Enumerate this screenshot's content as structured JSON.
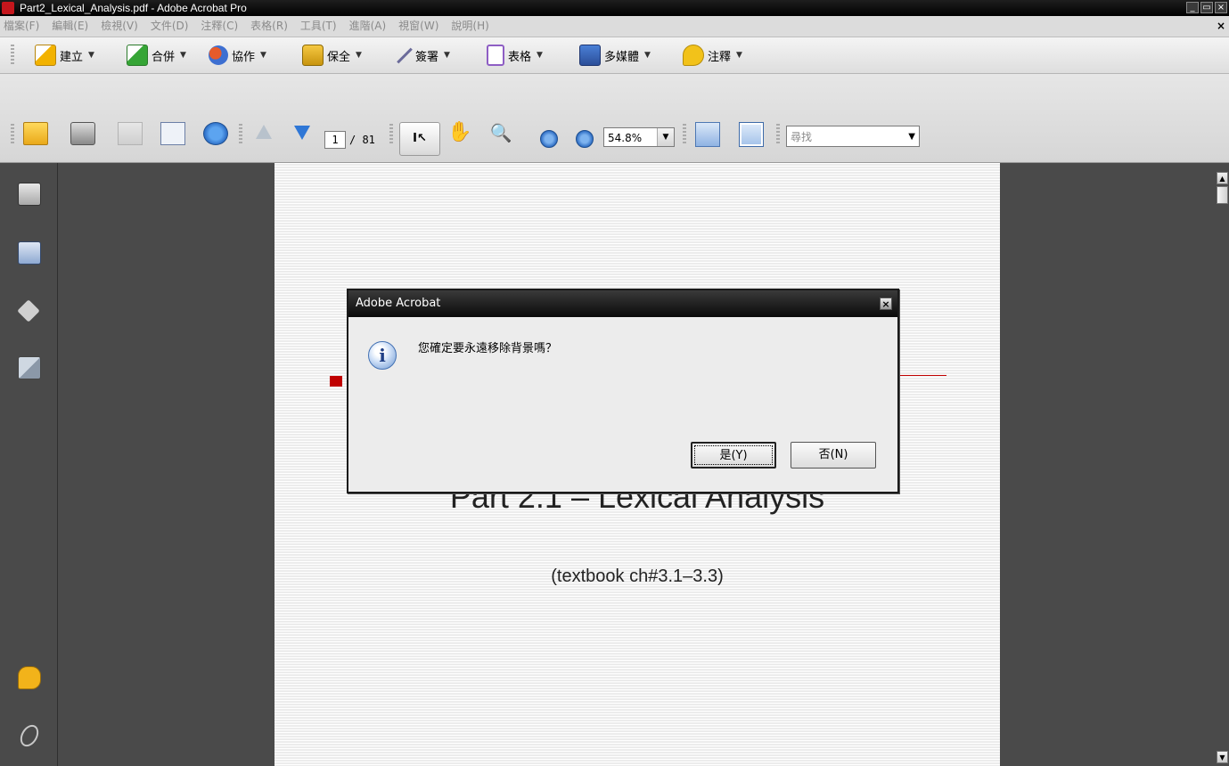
{
  "window": {
    "title": "Part2_Lexical_Analysis.pdf - Adobe Acrobat Pro",
    "controls": [
      "minimize",
      "restore",
      "close"
    ]
  },
  "menubar": {
    "items": [
      "檔案(F)",
      "編輯(E)",
      "檢視(V)",
      "文件(D)",
      "注釋(C)",
      "表格(R)",
      "工具(T)",
      "進階(A)",
      "視窗(W)",
      "說明(H)"
    ],
    "close_symbol": "×"
  },
  "toolbar_tasks": {
    "items": [
      {
        "label": "建立",
        "icon": "create-pdf-icon"
      },
      {
        "label": "合併",
        "icon": "combine-icon"
      },
      {
        "label": "協作",
        "icon": "collaborate-icon"
      },
      {
        "label": "保全",
        "icon": "secure-lock-icon"
      },
      {
        "label": "簽署",
        "icon": "sign-pen-icon"
      },
      {
        "label": "表格",
        "icon": "forms-icon"
      },
      {
        "label": "多媒體",
        "icon": "multimedia-icon"
      },
      {
        "label": "注釋",
        "icon": "comment-icon"
      }
    ]
  },
  "toolbar_nav": {
    "current_page": "1",
    "total_pages": "/ 81",
    "select_tool_label": "I↖",
    "zoom_value": "54.8%",
    "find_placeholder": "尋找"
  },
  "document": {
    "heading": "Part 2.1 – Lexical Analysis",
    "subheading": "(textbook ch#3.1–3.3)"
  },
  "dialog": {
    "title": "Adobe Acrobat",
    "message": "您確定要永遠移除背景嗎？",
    "yes_label": "是(Y)",
    "no_label": "否(N)",
    "icon": "info-icon"
  },
  "colors": {
    "accent_red": "#c00000",
    "titlebar": "#000000",
    "workspace": "#4a4a4a"
  }
}
